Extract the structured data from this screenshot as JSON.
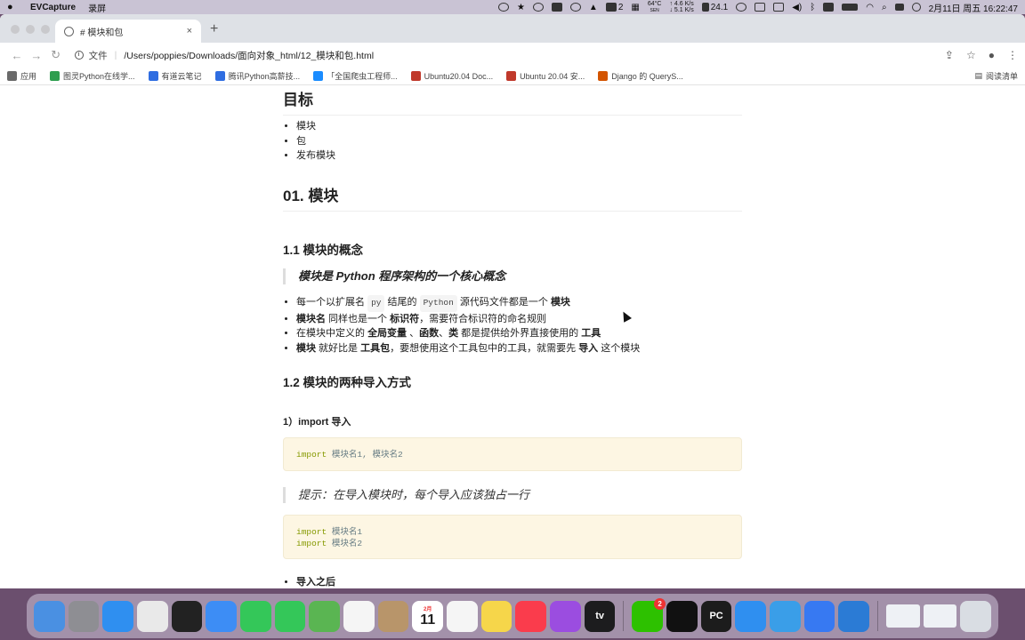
{
  "menubar": {
    "app_name": "EVCapture",
    "menu_item": "录屏",
    "temp": "64°C",
    "temp_sub": "SEN",
    "net_up": "4.6 K/s",
    "net_down": "5.1 K/s",
    "badge_count": "2",
    "battery_pct": "24.1",
    "datetime": "2月11日 周五 16:22:47"
  },
  "tab": {
    "title": "# 模块和包"
  },
  "toolbar": {
    "scheme_label": "文件",
    "url": "/Users/poppies/Downloads/面向对象_html/12_模块和包.html"
  },
  "bookmarks": {
    "items": [
      {
        "label": "应用",
        "color": "#6a6a6a"
      },
      {
        "label": "图灵Python在线学...",
        "color": "#2e9e4f"
      },
      {
        "label": "有道云笔记",
        "color": "#2f6de1"
      },
      {
        "label": "腾讯Python高薪技...",
        "color": "#2f6de1"
      },
      {
        "label": "「全国爬虫工程师...",
        "color": "#1a8cff"
      },
      {
        "label": "Ubuntu20.04 Doc...",
        "color": "#c0392b"
      },
      {
        "label": "Ubuntu 20.04 安...",
        "color": "#c0392b"
      },
      {
        "label": "Django 的 QueryS...",
        "color": "#d35400"
      }
    ],
    "reading_list": "阅读清单"
  },
  "doc": {
    "h_goal": "目标",
    "goal_items": [
      "模块",
      "包",
      "发布模块"
    ],
    "h_module": "01. 模块",
    "h_concept": "1.1 模块的概念",
    "quote_concept": "模块是 Python 程序架构的一个核心概念",
    "concept_items": {
      "i1_a": "每一个以扩展名 ",
      "i1_code1": "py",
      "i1_b": " 结尾的 ",
      "i1_code2": "Python",
      "i1_c": " 源代码文件都是一个 ",
      "i1_bold": "模块",
      "i2_bold": "模块名",
      "i2_a": " 同样也是一个 ",
      "i2_bold2": "标识符",
      "i2_b": "，需要符合标识符的命名规则",
      "i3_a": "在模块中定义的 ",
      "i3_b1": "全局变量",
      "i3_s1": " 、",
      "i3_b2": "函数",
      "i3_s2": "、",
      "i3_b3": "类",
      "i3_c": " 都是提供给外界直接使用的 ",
      "i3_b4": "工具",
      "i4_b1": "模块",
      "i4_a": " 就好比是 ",
      "i4_b2": "工具包",
      "i4_b": "，要想使用这个工具包中的工具，就需要先 ",
      "i4_b3": "导入",
      "i4_c": " 这个模块"
    },
    "h_import": "1.2 模块的两种导入方式",
    "h_import1": "1）import 导入",
    "code1_kw": "import",
    "code1_rest": " 模块名1, 模块名2",
    "quote_tip": "提示：在导入模块时，每个导入应该独占一行",
    "code2_line1_kw": "import",
    "code2_line1_rest": " 模块名1",
    "code2_line2_kw": "import",
    "code2_line2_rest": " 模块名2",
    "after_import": "导入之后"
  },
  "dock": {
    "apps": [
      {
        "name": "finder",
        "color": "#4a90e2"
      },
      {
        "name": "launchpad",
        "color": "#8e8e93"
      },
      {
        "name": "safari",
        "color": "#2f8ff0"
      },
      {
        "name": "chrome",
        "color": "#e9e9e9"
      },
      {
        "name": "terminal",
        "color": "#222222"
      },
      {
        "name": "mail",
        "color": "#3d8df5"
      },
      {
        "name": "facetime",
        "color": "#34c759"
      },
      {
        "name": "messages",
        "color": "#34c759"
      },
      {
        "name": "maps",
        "color": "#5ab552"
      },
      {
        "name": "photos",
        "color": "#f5f5f5"
      },
      {
        "name": "contacts",
        "color": "#b8956a"
      },
      {
        "name": "calendar",
        "color": "#ffffff"
      },
      {
        "name": "reminders",
        "color": "#f5f5f5"
      },
      {
        "name": "notes",
        "color": "#f6d64a"
      },
      {
        "name": "music",
        "color": "#fa3c4c"
      },
      {
        "name": "podcasts",
        "color": "#9b4de0"
      },
      {
        "name": "tv",
        "color": "#1c1c1e"
      },
      {
        "name": "wechat",
        "color": "#2dc100"
      },
      {
        "name": "qq",
        "color": "#111111"
      },
      {
        "name": "pycharm",
        "color": "#1c1c1c"
      },
      {
        "name": "quickq",
        "color": "#2f8ff0"
      },
      {
        "name": "evcapture",
        "color": "#3a9ee8"
      },
      {
        "name": "baidu-netdisk",
        "color": "#3779f2"
      },
      {
        "name": "vscode",
        "color": "#2b7bd5"
      }
    ],
    "wechat_badge": "2",
    "calendar_month": "2月",
    "calendar_day": "11",
    "tv_label": "tv",
    "pycharm_label": "PC"
  }
}
